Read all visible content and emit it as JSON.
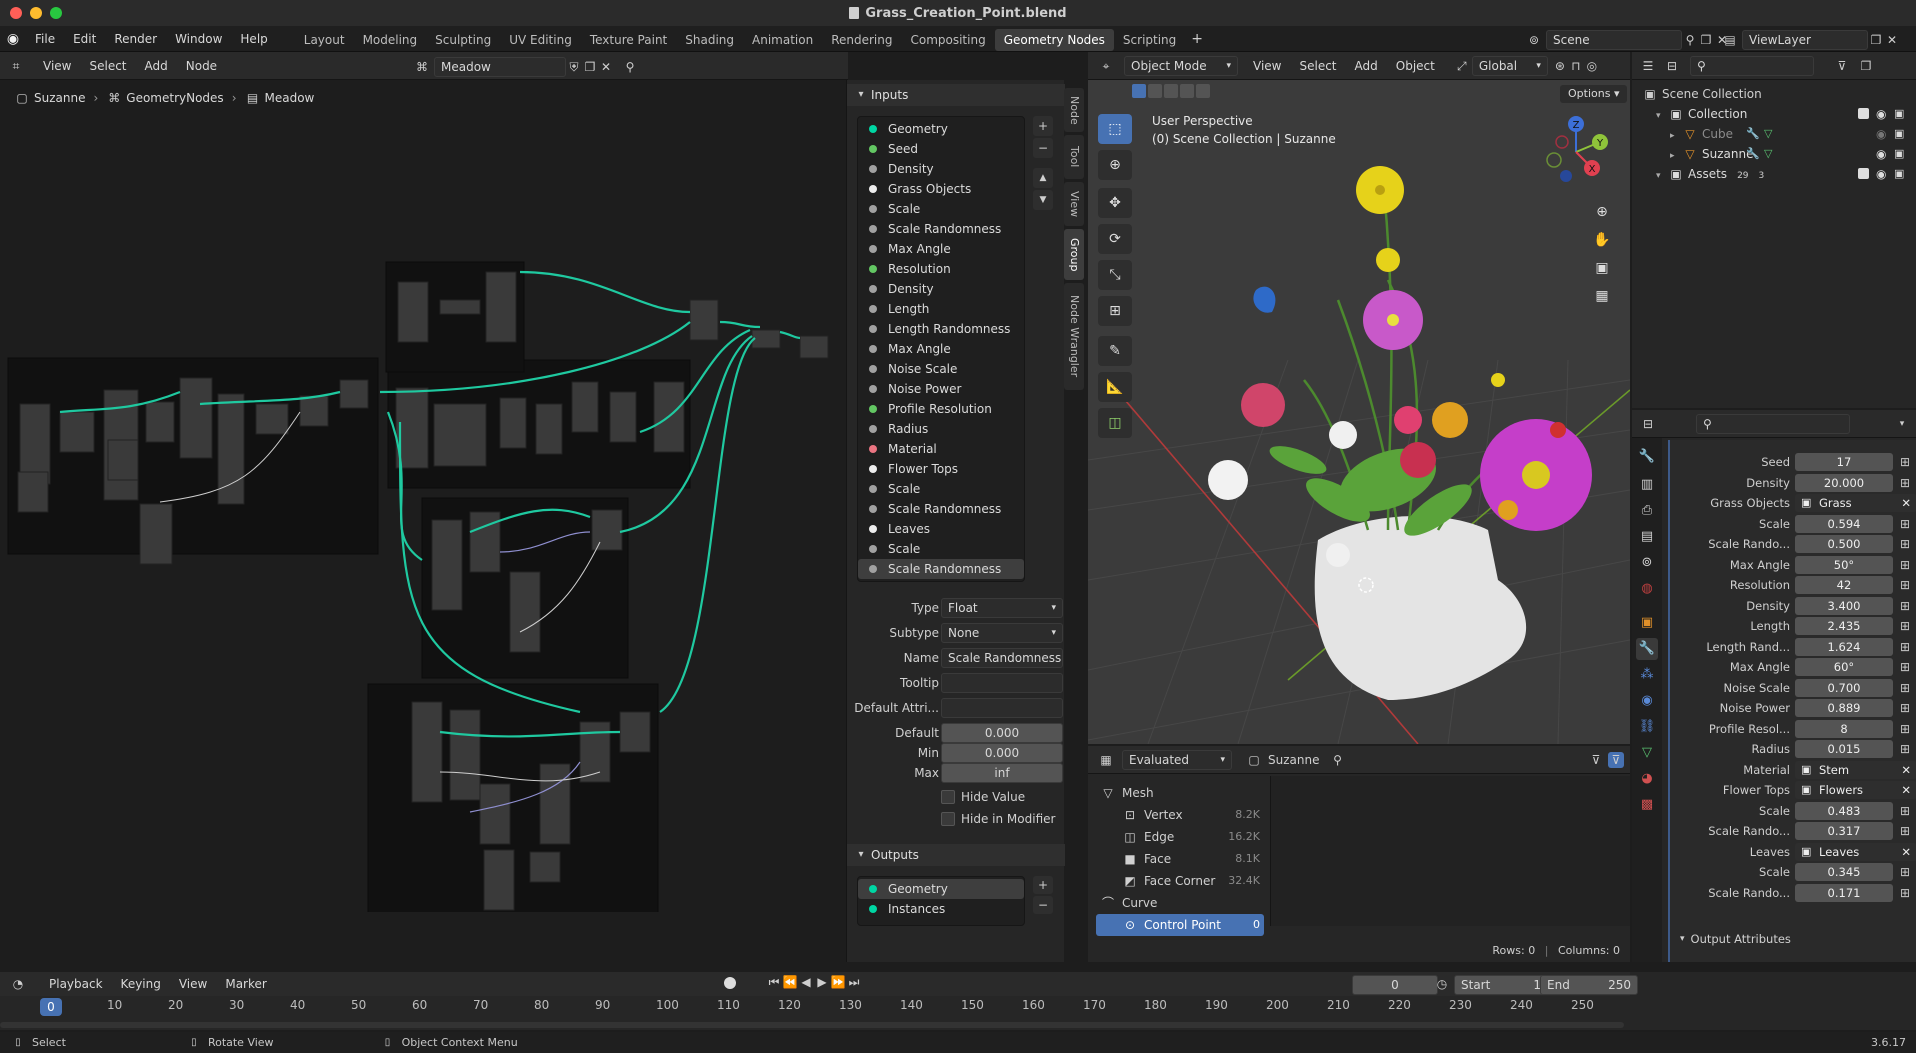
{
  "window": {
    "title": "Grass_Creation_Point.blend"
  },
  "menus": [
    "File",
    "Edit",
    "Render",
    "Window",
    "Help"
  ],
  "workspaces": [
    "Layout",
    "Modeling",
    "Sculpting",
    "UV Editing",
    "Texture Paint",
    "Shading",
    "Animation",
    "Rendering",
    "Compositing",
    "Geometry Nodes",
    "Scripting"
  ],
  "active_workspace": "Geometry Nodes",
  "scene": "Scene",
  "view_layer": "ViewLayer",
  "node_editor": {
    "menus": [
      "View",
      "Select",
      "Add",
      "Node"
    ],
    "node_group": "Meadow",
    "breadcrumb": [
      "Suzanne",
      "GeometryNodes",
      "Meadow"
    ]
  },
  "sidebar_tabs": [
    "Node",
    "Tool",
    "View",
    "Group",
    "Node Wrangler"
  ],
  "group_panel": {
    "inputs_title": "Inputs",
    "inputs": [
      {
        "name": "Geometry",
        "color": "#00d6a3"
      },
      {
        "name": "Seed",
        "color": "#63c763"
      },
      {
        "name": "Density",
        "color": "#a1a1a1"
      },
      {
        "name": "Grass Objects",
        "color": "#ededed"
      },
      {
        "name": "Scale",
        "color": "#a1a1a1"
      },
      {
        "name": "Scale Randomness",
        "color": "#a1a1a1"
      },
      {
        "name": "Max Angle",
        "color": "#a1a1a1"
      },
      {
        "name": "Resolution",
        "color": "#63c763"
      },
      {
        "name": "Density",
        "color": "#a1a1a1"
      },
      {
        "name": "Length",
        "color": "#a1a1a1"
      },
      {
        "name": "Length Randomness",
        "color": "#a1a1a1"
      },
      {
        "name": "Max Angle",
        "color": "#a1a1a1"
      },
      {
        "name": "Noise Scale",
        "color": "#a1a1a1"
      },
      {
        "name": "Noise Power",
        "color": "#a1a1a1"
      },
      {
        "name": "Profile Resolution",
        "color": "#63c763"
      },
      {
        "name": "Radius",
        "color": "#a1a1a1"
      },
      {
        "name": "Material",
        "color": "#eb7582"
      },
      {
        "name": "Flower Tops",
        "color": "#ededed"
      },
      {
        "name": "Scale",
        "color": "#a1a1a1"
      },
      {
        "name": "Scale Randomness",
        "color": "#a1a1a1"
      },
      {
        "name": "Leaves",
        "color": "#ededed"
      },
      {
        "name": "Scale",
        "color": "#a1a1a1"
      },
      {
        "name": "Scale Randomness",
        "color": "#a1a1a1"
      }
    ],
    "selected_index": 22,
    "props": {
      "type_label": "Type",
      "type_value": "Float",
      "subtype_label": "Subtype",
      "subtype_value": "None",
      "name_label": "Name",
      "name_value": "Scale Randomness",
      "tooltip_label": "Tooltip",
      "tooltip_value": "",
      "default_attr_label": "Default Attri...",
      "default_attr_value": "",
      "default_label": "Default",
      "default_value": "0.000",
      "min_label": "Min",
      "min_value": "0.000",
      "max_label": "Max",
      "max_value": "inf",
      "hide_value": "Hide Value",
      "hide_in_modifier": "Hide in Modifier"
    },
    "outputs_title": "Outputs",
    "outputs": [
      {
        "name": "Geometry",
        "color": "#00d6a3"
      },
      {
        "name": "Instances",
        "color": "#00d6a3"
      }
    ]
  },
  "viewport": {
    "mode": "Object Mode",
    "menus": [
      "View",
      "Select",
      "Add",
      "Object"
    ],
    "orientation": "Global",
    "options": "Options",
    "perspective": "User Perspective",
    "context": "(0) Scene Collection | Suzanne",
    "axes": {
      "x": "X",
      "y": "Y",
      "z": "Z"
    }
  },
  "spreadsheet": {
    "eval_mode": "Evaluated",
    "object": "Suzanne",
    "tree": [
      {
        "label": "Mesh",
        "count": "",
        "level": 0
      },
      {
        "label": "Vertex",
        "count": "8.2K",
        "level": 1
      },
      {
        "label": "Edge",
        "count": "16.2K",
        "level": 1
      },
      {
        "label": "Face",
        "count": "8.1K",
        "level": 1
      },
      {
        "label": "Face Corner",
        "count": "32.4K",
        "level": 1
      },
      {
        "label": "Curve",
        "count": "",
        "level": 0
      },
      {
        "label": "Control Point",
        "count": "0",
        "level": 1
      }
    ],
    "rows": "Rows: 0",
    "columns": "Columns: 0"
  },
  "outliner": {
    "scene_collection": "Scene Collection",
    "items": [
      {
        "label": "Collection",
        "level": 1
      },
      {
        "label": "Cube",
        "level": 2
      },
      {
        "label": "Suzanne",
        "level": 2
      },
      {
        "label": "Assets",
        "level": 1
      }
    ],
    "assets_badges": [
      "29",
      "3"
    ]
  },
  "modifier": {
    "props": [
      {
        "label": "Seed",
        "value": "17",
        "kind": "num"
      },
      {
        "label": "Density",
        "value": "20.000",
        "kind": "num"
      },
      {
        "label": "Grass Objects",
        "value": "Grass",
        "kind": "obj"
      },
      {
        "label": "Scale",
        "value": "0.594",
        "kind": "num"
      },
      {
        "label": "Scale Rando...",
        "value": "0.500",
        "kind": "num"
      },
      {
        "label": "Max Angle",
        "value": "50°",
        "kind": "num"
      },
      {
        "label": "Resolution",
        "value": "42",
        "kind": "num"
      },
      {
        "label": "Density",
        "value": "3.400",
        "kind": "num"
      },
      {
        "label": "Length",
        "value": "2.435",
        "kind": "num"
      },
      {
        "label": "Length Rand...",
        "value": "1.624",
        "kind": "num"
      },
      {
        "label": "Max Angle",
        "value": "60°",
        "kind": "num"
      },
      {
        "label": "Noise Scale",
        "value": "0.700",
        "kind": "num"
      },
      {
        "label": "Noise Power",
        "value": "0.889",
        "kind": "num"
      },
      {
        "label": "Profile Resol...",
        "value": "8",
        "kind": "num"
      },
      {
        "label": "Radius",
        "value": "0.015",
        "kind": "num"
      },
      {
        "label": "Material",
        "value": "Stem",
        "kind": "obj"
      },
      {
        "label": "Flower Tops",
        "value": "Flowers",
        "kind": "obj"
      },
      {
        "label": "Scale",
        "value": "0.483",
        "kind": "num"
      },
      {
        "label": "Scale Rando...",
        "value": "0.317",
        "kind": "num"
      },
      {
        "label": "Leaves",
        "value": "Leaves",
        "kind": "obj"
      },
      {
        "label": "Scale",
        "value": "0.345",
        "kind": "num"
      },
      {
        "label": "Scale Rando...",
        "value": "0.171",
        "kind": "num"
      }
    ],
    "output_attributes": "Output Attributes"
  },
  "timeline": {
    "menus": [
      "Playback",
      "Keying",
      "View",
      "Marker"
    ],
    "current_frame": "0",
    "start_label": "Start",
    "start": "1",
    "end_label": "End",
    "end": "250",
    "ticks": [
      "0",
      "10",
      "20",
      "30",
      "40",
      "50",
      "60",
      "70",
      "80",
      "90",
      "100",
      "110",
      "120",
      "130",
      "140",
      "150",
      "160",
      "170",
      "180",
      "190",
      "200",
      "210",
      "220",
      "230",
      "240",
      "250"
    ]
  },
  "statusbar": {
    "select": "Select",
    "rotate": "Rotate View",
    "context_menu": "Object Context Menu",
    "version": "3.6.17"
  }
}
